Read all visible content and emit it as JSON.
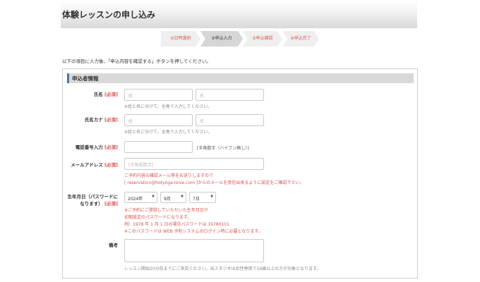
{
  "header": {
    "title": "体験レッスンの申し込み"
  },
  "steps": [
    "①日時選択",
    "②申込入力",
    "③申込確認",
    "④申込完了"
  ],
  "intro": "以下の項目に入力後、「申込内容を確認する」ボタンを押してください。",
  "section_title": "申込者情報",
  "required_mark": "[必須]",
  "name": {
    "label": "氏名",
    "last_placeholder": "姓",
    "first_placeholder": "名",
    "note": "※姓と名に分けて、全角で入力してください。"
  },
  "kana": {
    "label": "氏名カナ",
    "last_placeholder": "姓",
    "first_placeholder": "名",
    "note": "※姓と名に分けて、全角で入力してください。"
  },
  "phone": {
    "label": "電話番号入力",
    "note": "[半角数字（ハイフン無し）]"
  },
  "email": {
    "label": "メールアドレス",
    "placeholder": "[半角英数字]",
    "note_line1": "ご予約内容の確認メール等をお送りしますので",
    "note_line2": "[ reservation@hotyoga-loive.com ]からのメールを受信出来るように設定をご確認下さい。"
  },
  "birthday": {
    "label_line1": "生年月日（パスワードに",
    "label_line2": "なります）",
    "year": "2024年",
    "month": "9月",
    "day": "7日",
    "note_line1": "※ご予約にご登録していただいた生年月日が",
    "note_line2": "初期設定のパスワードになります。",
    "note_line3": "例）1978 年 1 月 1 日の場合パスワードは 19780101",
    "note_line4": "※このパスワードは WEB 予約システムのログイン時に必要となります。"
  },
  "remarks": {
    "label": "備考",
    "note": "レッスン開始20分前までにご来店ください。当スタジオは女性専用で16歳以上の方が対象となります。"
  },
  "colors": {
    "required": "#d9534f",
    "accent": "#4a78a8",
    "step_active": "#d6d6d6"
  }
}
